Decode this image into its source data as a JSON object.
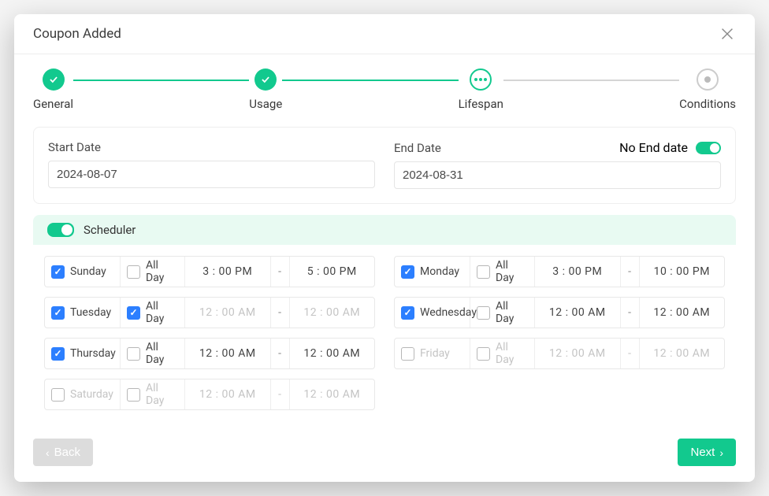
{
  "modal": {
    "title": "Coupon Added"
  },
  "stepper": {
    "steps": [
      {
        "label": "General",
        "state": "done"
      },
      {
        "label": "Usage",
        "state": "done"
      },
      {
        "label": "Lifespan",
        "state": "current"
      },
      {
        "label": "Conditions",
        "state": "pending"
      }
    ]
  },
  "dates": {
    "start_label": "Start Date",
    "start_value": "2024-08-07",
    "end_label": "End Date",
    "end_value": "2024-08-31",
    "no_end_label": "No End date",
    "no_end_on": true
  },
  "scheduler": {
    "label": "Scheduler",
    "on": true,
    "all_day_label": "All Day",
    "days": [
      {
        "name": "Sunday",
        "enabled": true,
        "all_day": false,
        "from": "3 : 00  PM",
        "to": "5 : 00  PM"
      },
      {
        "name": "Monday",
        "enabled": true,
        "all_day": false,
        "from": "3 : 00  PM",
        "to": "10 : 00  PM"
      },
      {
        "name": "Tuesday",
        "enabled": true,
        "all_day": true,
        "from": "12 : 00  AM",
        "to": "12 : 00  AM"
      },
      {
        "name": "Wednesday",
        "enabled": true,
        "all_day": false,
        "from": "12 : 00  AM",
        "to": "12 : 00  AM"
      },
      {
        "name": "Thursday",
        "enabled": true,
        "all_day": false,
        "from": "12 : 00  AM",
        "to": "12 : 00  AM"
      },
      {
        "name": "Friday",
        "enabled": false,
        "all_day": false,
        "from": "12 : 00  AM",
        "to": "12 : 00  AM"
      },
      {
        "name": "Saturday",
        "enabled": false,
        "all_day": false,
        "from": "12 : 00  AM",
        "to": "12 : 00  AM"
      }
    ]
  },
  "footer": {
    "back": "Back",
    "next": "Next"
  },
  "colors": {
    "accent": "#12c98e",
    "checkbox": "#2c7fff"
  }
}
